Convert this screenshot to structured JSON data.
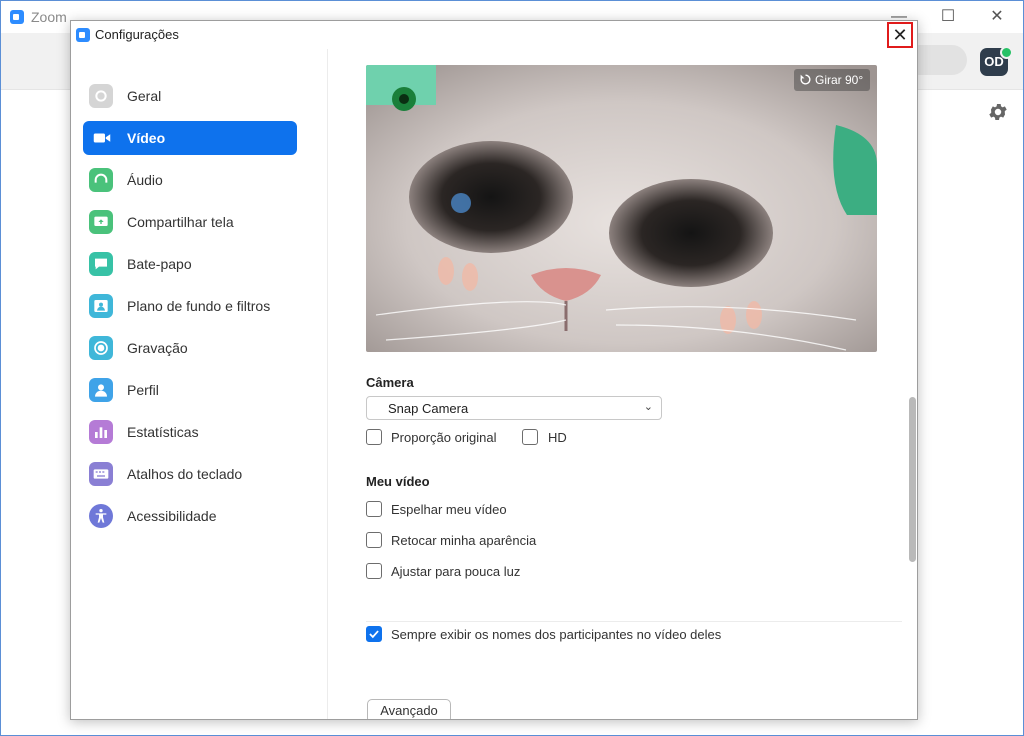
{
  "app": {
    "title": "Zoom",
    "avatar_initials": "OD"
  },
  "dialog": {
    "title": "Configurações",
    "close_glyph": "✕"
  },
  "sidebar": {
    "items": [
      {
        "label": "Geral",
        "icon": "gear-icon",
        "color": "#d5d5d5"
      },
      {
        "label": "Vídeo",
        "icon": "video-camera-icon",
        "color": "#0e72ed",
        "active": true
      },
      {
        "label": "Áudio",
        "icon": "headphones-icon",
        "color": "#4ac27b"
      },
      {
        "label": "Compartilhar tela",
        "icon": "share-screen-icon",
        "color": "#4ac27b"
      },
      {
        "label": "Bate-papo",
        "icon": "chat-bubble-icon",
        "color": "#37c2a6"
      },
      {
        "label": "Plano de fundo e filtros",
        "icon": "person-background-icon",
        "color": "#3fb7d9"
      },
      {
        "label": "Gravação",
        "icon": "record-icon",
        "color": "#3fb7d9"
      },
      {
        "label": "Perfil",
        "icon": "profile-icon",
        "color": "#3fa3e8"
      },
      {
        "label": "Estatísticas",
        "icon": "statistics-icon",
        "color": "#b57bd6"
      },
      {
        "label": "Atalhos do teclado",
        "icon": "keyboard-icon",
        "color": "#8a7fd4"
      },
      {
        "label": "Acessibilidade",
        "icon": "accessibility-icon",
        "color": "#6f78d8"
      }
    ]
  },
  "video": {
    "rotate_label": "Girar 90°",
    "camera_heading": "Câmera",
    "camera_selected": "Snap Camera",
    "original_ratio_label": "Proporção original",
    "original_ratio_checked": false,
    "hd_label": "HD",
    "hd_checked": false,
    "my_video_heading": "Meu vídeo",
    "mirror_label": "Espelhar meu vídeo",
    "mirror_checked": false,
    "touch_up_label": "Retocar minha aparência",
    "touch_up_checked": false,
    "low_light_label": "Ajustar para pouca luz",
    "low_light_checked": false,
    "show_names_label": "Sempre exibir os nomes dos participantes no vídeo deles",
    "show_names_checked": true,
    "advanced_label": "Avançado"
  },
  "colors": {
    "accent": "#0e72ed",
    "close_highlight": "#e01b1b",
    "online_status": "#26c165"
  }
}
